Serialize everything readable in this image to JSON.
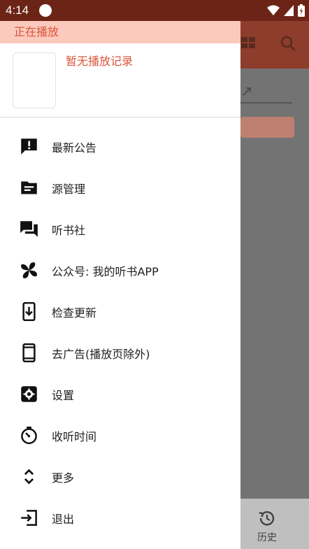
{
  "status": {
    "time": "4:14"
  },
  "now_playing": {
    "header": "正在播放",
    "empty_text": "暂无播放记录"
  },
  "menu": [
    {
      "label": "最新公告",
      "icon": "announcement-icon"
    },
    {
      "label": "源管理",
      "icon": "folder-icon"
    },
    {
      "label": "听书社",
      "icon": "forum-icon"
    },
    {
      "label": "公众号: 我的听书APP",
      "icon": "pinwheel-icon"
    },
    {
      "label": "检查更新",
      "icon": "system-update-icon"
    },
    {
      "label": "去广告(播放页除外)",
      "icon": "phone-icon"
    },
    {
      "label": "设置",
      "icon": "settings-icon"
    },
    {
      "label": "收听时间",
      "icon": "timer-icon"
    },
    {
      "label": "更多",
      "icon": "unfold-more-icon"
    },
    {
      "label": "退出",
      "icon": "exit-icon"
    }
  ],
  "bottom_nav": {
    "history_label": "历史"
  },
  "colors": {
    "accent": "#d9553a",
    "status_bar": "#6b2416",
    "app_bar": "#8e3d2c",
    "playing_strip": "#fbc9bd"
  }
}
